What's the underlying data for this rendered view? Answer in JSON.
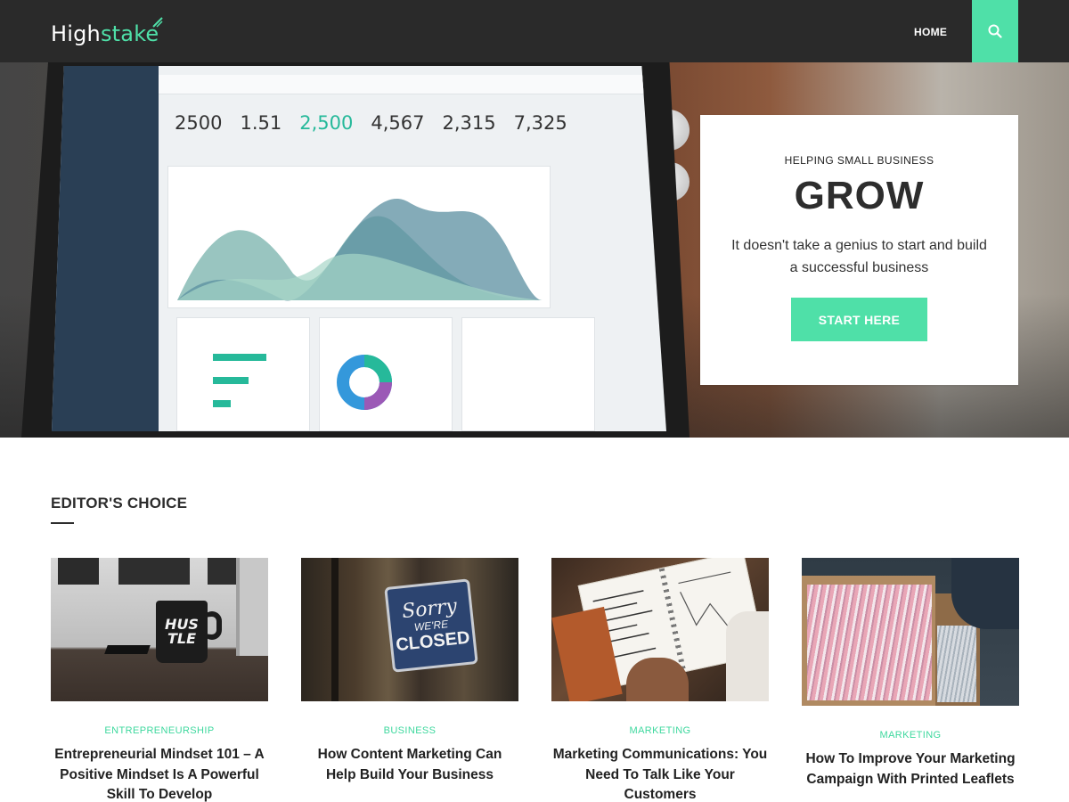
{
  "header": {
    "logo_part1": "High",
    "logo_part2": "stake",
    "nav": [
      {
        "label": "HOME"
      }
    ],
    "icons": {
      "search": "search-icon"
    }
  },
  "hero": {
    "kicker": "HELPING SMALL BUSINESS",
    "title": "GROW",
    "text": "It doesn't take a genius to start and build a successful business",
    "cta_label": "START HERE",
    "screen_stats": [
      "2500",
      "1.51",
      "2,500",
      "4,567",
      "2,315",
      "7,325"
    ]
  },
  "section": {
    "title": "EDITOR'S CHOICE"
  },
  "cards": [
    {
      "category": "ENTREPRENEURSHIP",
      "title": "Entrepreneurial Mindset 101 – A Positive Mindset Is A Powerful Skill To Develop",
      "image_text_1": "HUS",
      "image_text_2": "TLE"
    },
    {
      "category": "BUSINESS",
      "title": "How Content Marketing Can Help Build Your Business",
      "image_text_1": "Sorry",
      "image_text_2": "WE'RE",
      "image_text_3": "CLOSED"
    },
    {
      "category": "MARKETING",
      "title": "Marketing Communications: You Need To Talk Like Your Customers"
    },
    {
      "category": "MARKETING",
      "title": "How To Improve Your Marketing Campaign With Printed Leaflets"
    }
  ],
  "colors": {
    "accent": "#4fe0a8",
    "header_bg": "#2a2a2a",
    "category_text": "#3ed89e"
  }
}
